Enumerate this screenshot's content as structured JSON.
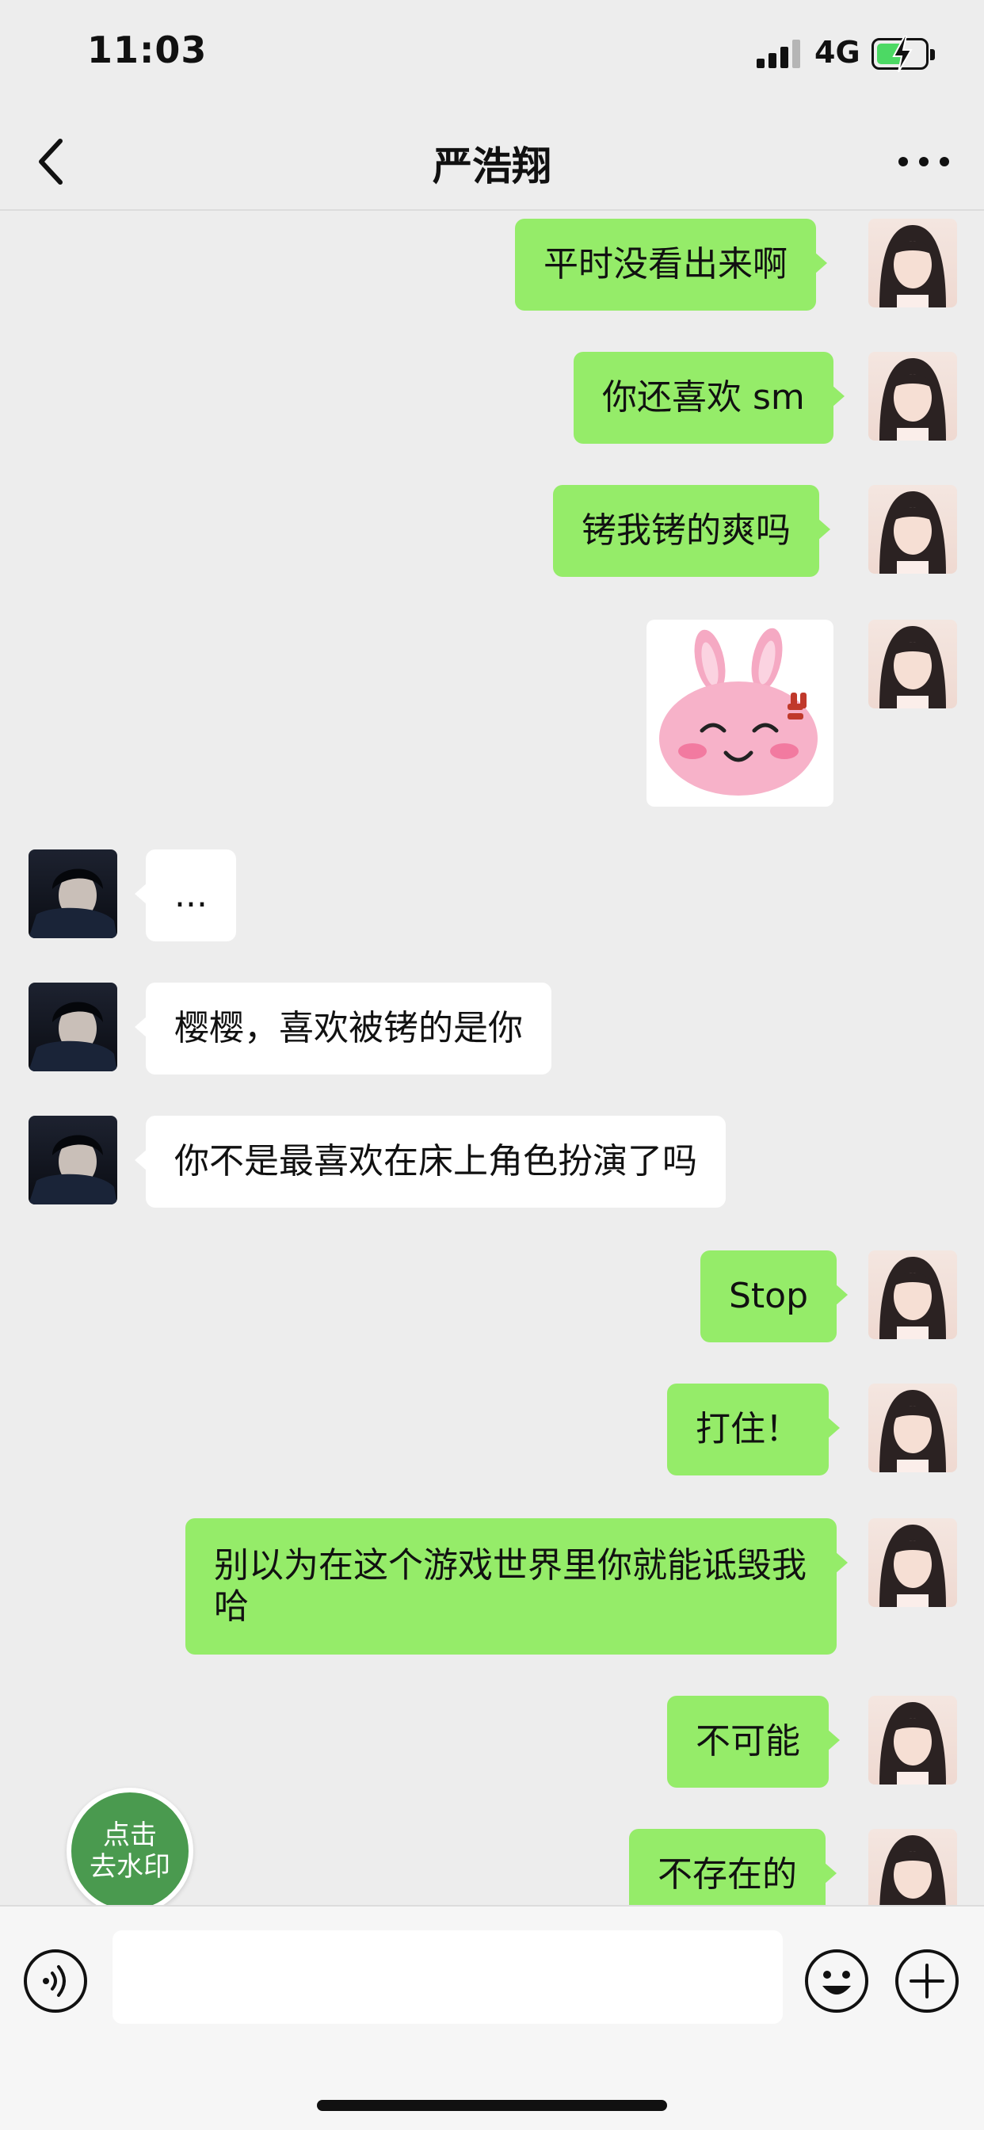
{
  "status_bar": {
    "time": "11:03",
    "network": "4G"
  },
  "header": {
    "title": "严浩翔"
  },
  "messages": [
    {
      "side": "out",
      "text": "平时没看出来啊"
    },
    {
      "side": "out",
      "text": "你还喜欢 sm"
    },
    {
      "side": "out",
      "text": "铐我铐的爽吗"
    },
    {
      "side": "out",
      "type": "sticker",
      "sticker": "angry-bunny-sticker"
    },
    {
      "side": "in",
      "text": "..."
    },
    {
      "side": "in",
      "text": "樱樱，喜欢被铐的是你"
    },
    {
      "side": "in",
      "text": "你不是最喜欢在床上角色扮演了吗"
    },
    {
      "side": "out",
      "text": "Stop"
    },
    {
      "side": "out",
      "text": "打住！"
    },
    {
      "side": "out",
      "text": "别以为在这个游戏世界里你就能诋毁我哈"
    },
    {
      "side": "out",
      "text": "不可能"
    },
    {
      "side": "out",
      "text": "不存在的"
    }
  ],
  "watermark_button": {
    "line1": "点击",
    "line2": "去水印"
  },
  "input_bar": {
    "value": ""
  },
  "icons": {
    "back": "chevron-left-icon",
    "more": "more-dots-icon",
    "voice": "voice-icon",
    "emoji": "emoji-icon",
    "plus": "plus-icon"
  },
  "colors": {
    "outgoing_bubble": "#95ec69",
    "incoming_bubble": "#ffffff",
    "background": "#ededed",
    "watermark_button": "#4a9a4f"
  }
}
